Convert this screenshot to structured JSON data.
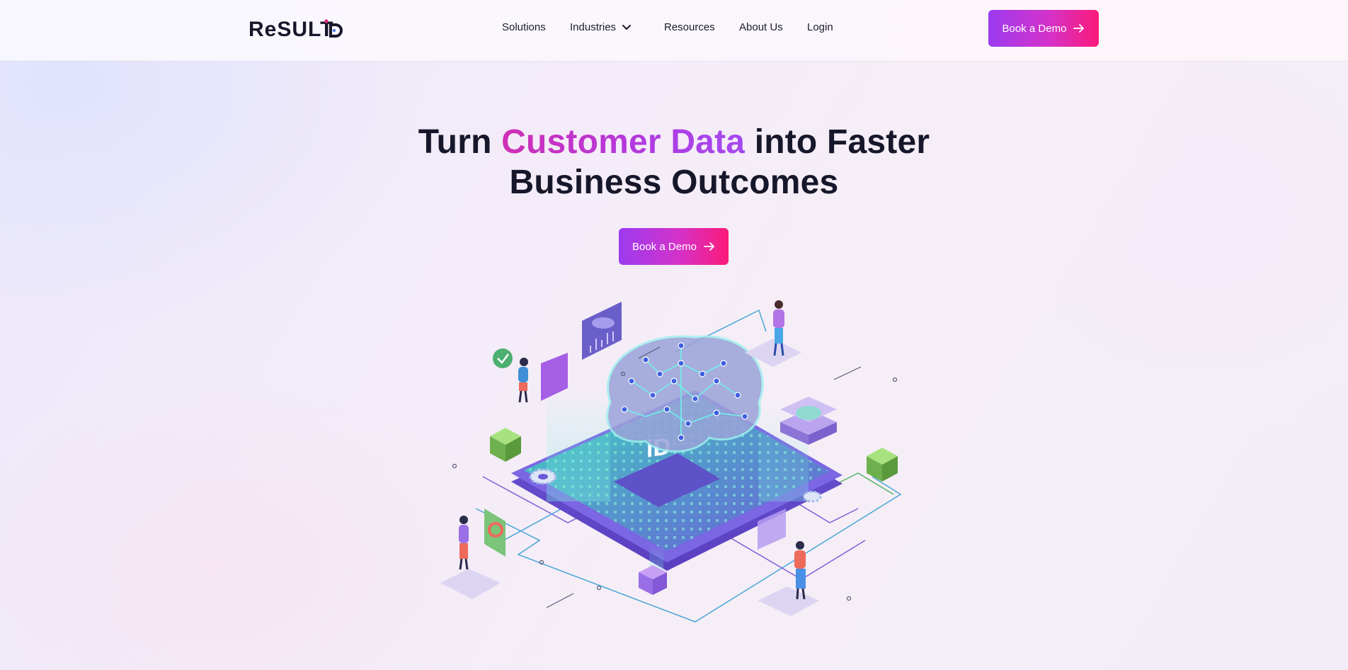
{
  "brand": {
    "logo_text": "resultid"
  },
  "nav": {
    "items": [
      {
        "label": "Solutions"
      },
      {
        "label": "Industries"
      },
      {
        "label": "Resources"
      },
      {
        "label": "About Us"
      },
      {
        "label": "Login"
      }
    ]
  },
  "header_cta": {
    "label": "Book a Demo"
  },
  "hero": {
    "title_start": "Turn ",
    "title_accent": "Customer Data",
    "title_mid": " into Faster",
    "title_line2": "Business Outcomes",
    "cta_label": "Book a Demo"
  },
  "colors": {
    "accent_purple": "#9c3bf0",
    "accent_pink": "#fb1a79",
    "heading": "#16172b"
  },
  "icons": [
    "chevron-down-icon",
    "arrow-right-icon"
  ]
}
